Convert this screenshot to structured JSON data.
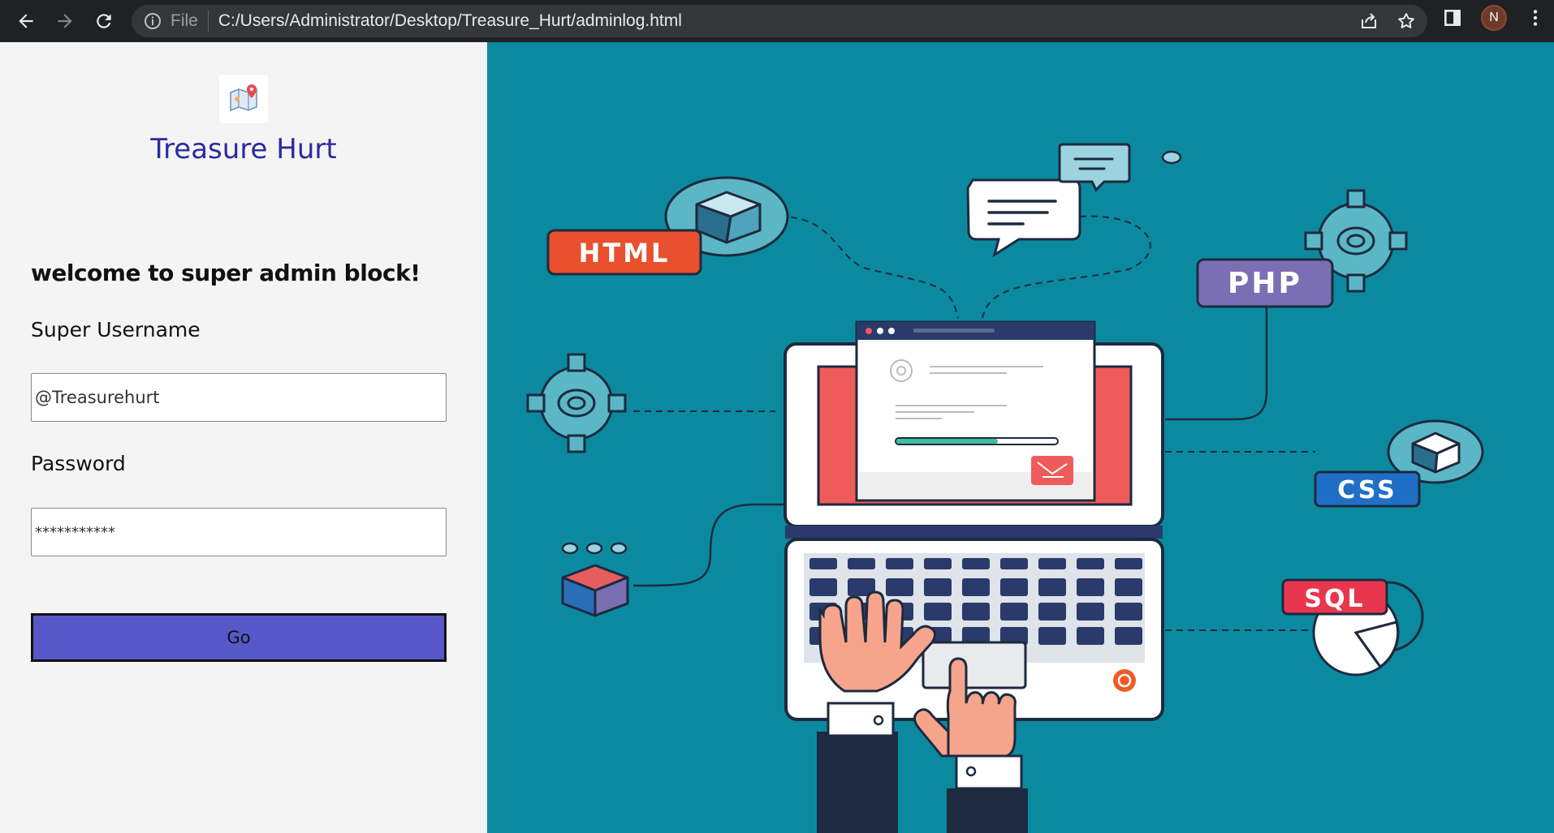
{
  "browser": {
    "file_label": "File",
    "url": "C:/Users/Administrator/Desktop/Treasure_Hurt/adminlog.html",
    "profile_initial": "N"
  },
  "brand": {
    "name": "Treasure Hurt",
    "color": "#2a2aa0"
  },
  "login": {
    "heading": "welcome to super admin block!",
    "username_label": "Super Username",
    "username_value": "@Treasurehurt",
    "password_label": "Password",
    "password_value": "***********",
    "submit_label": "Go",
    "button_color": "#5757c9"
  },
  "illustration": {
    "background": "#0b8a9f",
    "tags": {
      "html": "HTML",
      "php": "PHP",
      "css": "CSS",
      "sql": "SQL"
    }
  }
}
